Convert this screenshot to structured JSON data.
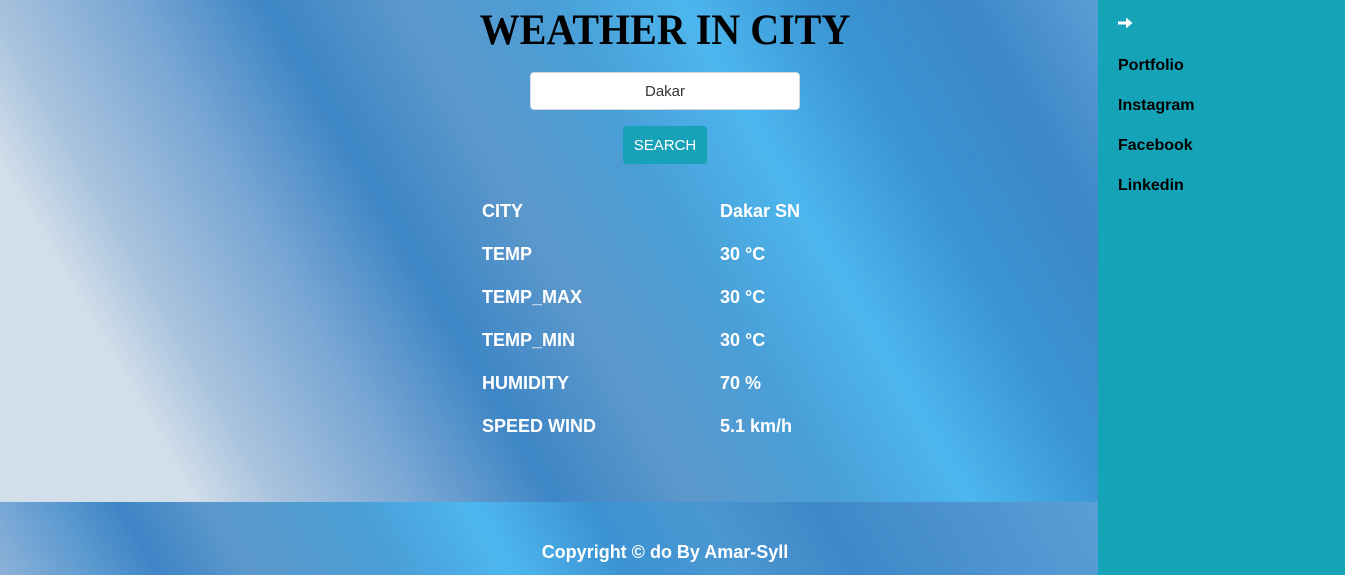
{
  "header": {
    "title": "WEATHER IN CITY"
  },
  "search": {
    "value": "Dakar",
    "button_label": "SEARCH"
  },
  "weather": {
    "rows": [
      {
        "label": "CITY",
        "value": "Dakar SN"
      },
      {
        "label": "TEMP",
        "value": "30 °C"
      },
      {
        "label": "TEMP_MAX",
        "value": "30 °C"
      },
      {
        "label": "TEMP_MIN",
        "value": "30 °C"
      },
      {
        "label": "HUMIDITY",
        "value": "70 %"
      },
      {
        "label": "SPEED WIND",
        "value": "5.1 km/h"
      }
    ]
  },
  "sidebar": {
    "toggle_icon": "arrow-right-icon",
    "items": [
      {
        "label": "Portfolio"
      },
      {
        "label": "Instagram"
      },
      {
        "label": "Facebook"
      },
      {
        "label": "Linkedin"
      }
    ]
  },
  "footer": {
    "text": "Copyright © do By Amar-Syll"
  },
  "colors": {
    "accent": "#17a2b8",
    "sidebar_bg": "#15a3b8",
    "text_light": "#ffffff"
  }
}
